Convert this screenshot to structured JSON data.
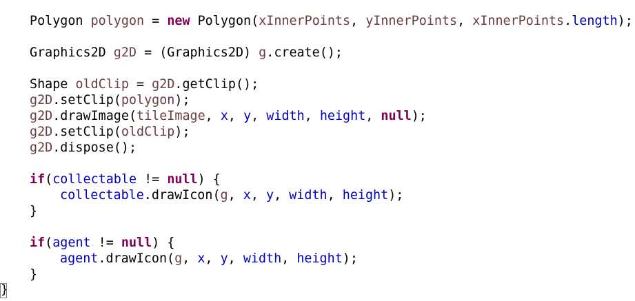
{
  "editor": {
    "lines": [
      {
        "tokens": [
          {
            "t": "Polygon ",
            "c": "plain"
          },
          {
            "t": "polygon",
            "c": "var"
          },
          {
            "t": " = ",
            "c": "plain"
          },
          {
            "t": "new",
            "c": "kw"
          },
          {
            "t": " Polygon(",
            "c": "plain"
          },
          {
            "t": "xInnerPoints",
            "c": "var"
          },
          {
            "t": ", ",
            "c": "plain"
          },
          {
            "t": "yInnerPoints",
            "c": "var"
          },
          {
            "t": ", ",
            "c": "plain"
          },
          {
            "t": "xInnerPoints",
            "c": "var"
          },
          {
            "t": ".",
            "c": "plain"
          },
          {
            "t": "length",
            "c": "field"
          },
          {
            "t": ");",
            "c": "plain"
          }
        ]
      },
      {
        "tokens": [
          {
            "t": "Graphics2D ",
            "c": "plain"
          },
          {
            "t": "g2D",
            "c": "var"
          },
          {
            "t": " = (Graphics2D) ",
            "c": "plain"
          },
          {
            "t": "g",
            "c": "var"
          },
          {
            "t": ".create();",
            "c": "plain"
          }
        ]
      },
      {
        "tokens": [
          {
            "t": "Shape ",
            "c": "plain"
          },
          {
            "t": "oldClip",
            "c": "var"
          },
          {
            "t": " = ",
            "c": "plain"
          },
          {
            "t": "g2D",
            "c": "var"
          },
          {
            "t": ".getClip();",
            "c": "plain"
          }
        ]
      },
      {
        "tokens": [
          {
            "t": "g2D",
            "c": "var"
          },
          {
            "t": ".setClip(",
            "c": "plain"
          },
          {
            "t": "polygon",
            "c": "var"
          },
          {
            "t": ");",
            "c": "plain"
          }
        ]
      },
      {
        "tokens": [
          {
            "t": "g2D",
            "c": "var"
          },
          {
            "t": ".drawImage(",
            "c": "plain"
          },
          {
            "t": "tileImage",
            "c": "var"
          },
          {
            "t": ", ",
            "c": "plain"
          },
          {
            "t": "x",
            "c": "field"
          },
          {
            "t": ", ",
            "c": "plain"
          },
          {
            "t": "y",
            "c": "field"
          },
          {
            "t": ", ",
            "c": "plain"
          },
          {
            "t": "width",
            "c": "field"
          },
          {
            "t": ", ",
            "c": "plain"
          },
          {
            "t": "height",
            "c": "field"
          },
          {
            "t": ", ",
            "c": "plain"
          },
          {
            "t": "null",
            "c": "kw"
          },
          {
            "t": ");",
            "c": "plain"
          }
        ]
      },
      {
        "tokens": [
          {
            "t": "g2D",
            "c": "var"
          },
          {
            "t": ".setClip(",
            "c": "plain"
          },
          {
            "t": "oldClip",
            "c": "var"
          },
          {
            "t": ");",
            "c": "plain"
          }
        ]
      },
      {
        "tokens": [
          {
            "t": "g2D",
            "c": "var"
          },
          {
            "t": ".dispose();",
            "c": "plain"
          }
        ]
      },
      {
        "tokens": [
          {
            "t": "if",
            "c": "kw"
          },
          {
            "t": "(",
            "c": "plain"
          },
          {
            "t": "collectable",
            "c": "field"
          },
          {
            "t": " != ",
            "c": "plain"
          },
          {
            "t": "null",
            "c": "kw"
          },
          {
            "t": ") {",
            "c": "plain"
          }
        ]
      },
      {
        "tokens": [
          {
            "t": "collectable",
            "c": "field"
          },
          {
            "t": ".drawIcon(",
            "c": "plain"
          },
          {
            "t": "g",
            "c": "var"
          },
          {
            "t": ", ",
            "c": "plain"
          },
          {
            "t": "x",
            "c": "field"
          },
          {
            "t": ", ",
            "c": "plain"
          },
          {
            "t": "y",
            "c": "field"
          },
          {
            "t": ", ",
            "c": "plain"
          },
          {
            "t": "width",
            "c": "field"
          },
          {
            "t": ", ",
            "c": "plain"
          },
          {
            "t": "height",
            "c": "field"
          },
          {
            "t": ");",
            "c": "plain"
          }
        ]
      },
      {
        "tokens": [
          {
            "t": "}",
            "c": "plain"
          }
        ]
      },
      {
        "tokens": [
          {
            "t": "if",
            "c": "kw"
          },
          {
            "t": "(",
            "c": "plain"
          },
          {
            "t": "agent",
            "c": "field"
          },
          {
            "t": " != ",
            "c": "plain"
          },
          {
            "t": "null",
            "c": "kw"
          },
          {
            "t": ") {",
            "c": "plain"
          }
        ]
      },
      {
        "tokens": [
          {
            "t": "agent",
            "c": "field"
          },
          {
            "t": ".drawIcon(",
            "c": "plain"
          },
          {
            "t": "g",
            "c": "var"
          },
          {
            "t": ", ",
            "c": "plain"
          },
          {
            "t": "x",
            "c": "field"
          },
          {
            "t": ", ",
            "c": "plain"
          },
          {
            "t": "y",
            "c": "field"
          },
          {
            "t": ", ",
            "c": "plain"
          },
          {
            "t": "width",
            "c": "field"
          },
          {
            "t": ", ",
            "c": "plain"
          },
          {
            "t": "height",
            "c": "field"
          },
          {
            "t": ");",
            "c": "plain"
          }
        ]
      },
      {
        "tokens": [
          {
            "t": "}",
            "c": "plain"
          }
        ]
      }
    ],
    "closing_brace": "}",
    "colors": {
      "keyword": "#7f0055",
      "variable": "#6a3e3e",
      "field": "#0000c0",
      "plain": "#000000",
      "background": "#ffffff"
    }
  }
}
